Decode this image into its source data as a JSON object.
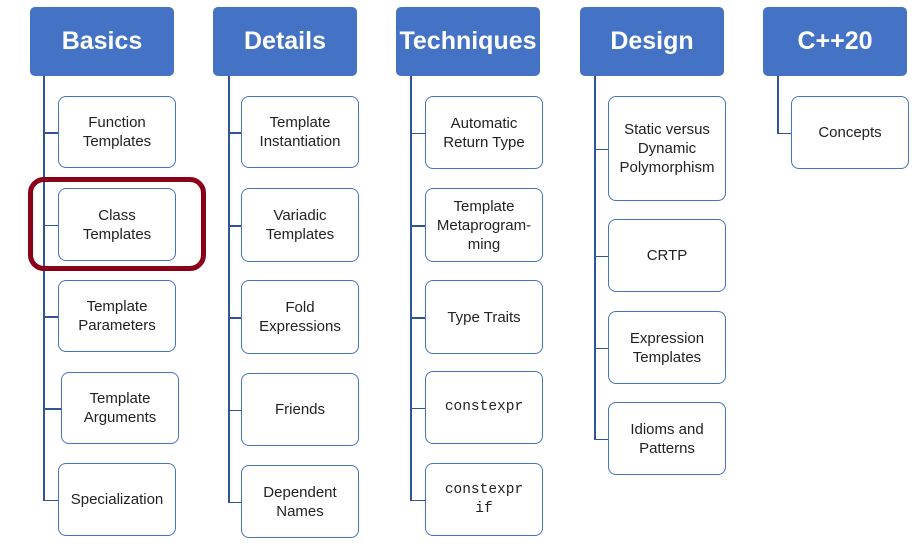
{
  "colors": {
    "header": "#4472C4",
    "connector": "#2F5597",
    "highlight": "#8B0019"
  },
  "highlighted": "Class Templates",
  "columns": [
    {
      "title": "Basics",
      "items": [
        {
          "label": "Function\nTemplates"
        },
        {
          "label": "Class\nTemplates",
          "highlighted": true
        },
        {
          "label": "Template\nParameters"
        },
        {
          "label": "Template\nArguments"
        },
        {
          "label": "Specialization"
        }
      ]
    },
    {
      "title": "Details",
      "items": [
        {
          "label": "Template\nInstantiation"
        },
        {
          "label": "Variadic\nTemplates"
        },
        {
          "label": "Fold\nExpressions"
        },
        {
          "label": "Friends"
        },
        {
          "label": "Dependent\nNames"
        }
      ]
    },
    {
      "title": "Techniques",
      "items": [
        {
          "label": "Automatic\nReturn Type"
        },
        {
          "label": "Template\nMetaprogram-\nming"
        },
        {
          "label": "Type Traits"
        },
        {
          "label": "constexpr",
          "code": true
        },
        {
          "label": "constexpr\nif",
          "code": true
        }
      ]
    },
    {
      "title": "Design",
      "items": [
        {
          "label": "Static versus\nDynamic\nPolymorphism"
        },
        {
          "label": "CRTP"
        },
        {
          "label": "Expression\nTemplates"
        },
        {
          "label": "Idioms and\nPatterns"
        }
      ]
    },
    {
      "title": "C++20",
      "items": [
        {
          "label": "Concepts"
        }
      ]
    }
  ]
}
